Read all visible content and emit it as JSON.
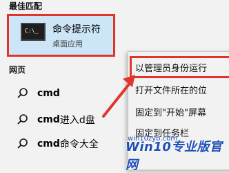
{
  "search_panel": {
    "best_match_header": "最佳匹配",
    "best_match": {
      "title": "命令提示符",
      "subtitle": "桌面应用",
      "icon": "terminal-icon"
    },
    "web_header": "网页",
    "web_results": [
      {
        "bold": "cmd",
        "rest": ""
      },
      {
        "bold": "cmd",
        "rest": " 进入d盘"
      },
      {
        "bold": "cmd",
        "rest": "命令大全"
      }
    ]
  },
  "context_menu": {
    "items": [
      "以管理员身份运行",
      "打开文件所在的位",
      "固定到\"开始\"屏幕",
      "固定到任务栏"
    ]
  },
  "watermark": {
    "text": "Win10专业版官网",
    "url": "win10zyb.com"
  },
  "colors": {
    "highlight_border": "#e0352b",
    "selection_bg": "#cde6f7",
    "panel_bg": "#f2f2f2"
  }
}
